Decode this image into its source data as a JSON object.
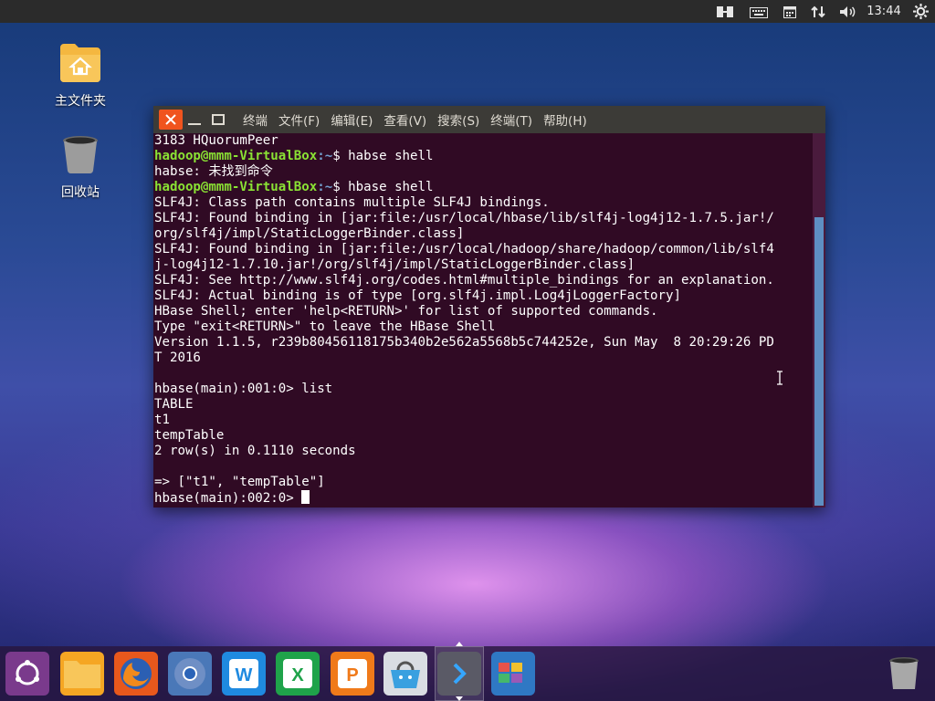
{
  "top_panel": {
    "clock": "13:44",
    "indicators": [
      "network-icon",
      "keyboard-icon",
      "calendar-icon",
      "transfer-icon",
      "volume-icon",
      "settings-gear-icon"
    ]
  },
  "desktop": {
    "icons": [
      {
        "label": "主文件夹",
        "icon": "home-folder-icon"
      },
      {
        "label": "回收站",
        "icon": "trash-icon"
      }
    ]
  },
  "terminal": {
    "menu": [
      "终端",
      "文件(F)",
      "编辑(E)",
      "查看(V)",
      "搜索(S)",
      "终端(T)",
      "帮助(H)"
    ],
    "prompt_user": "hadoop@mmm-VirtualBox",
    "prompt_path": ":~",
    "lines": [
      {
        "text": "3183 HQuorumPeer"
      },
      {
        "text": "$ habse shell",
        "prompt": true
      },
      {
        "text": "habse: 未找到命令"
      },
      {
        "text": "$ hbase shell",
        "prompt": true
      },
      {
        "text": "SLF4J: Class path contains multiple SLF4J bindings."
      },
      {
        "text": "SLF4J: Found binding in [jar:file:/usr/local/hbase/lib/slf4j-log4j12-1.7.5.jar!/"
      },
      {
        "text": "org/slf4j/impl/StaticLoggerBinder.class]"
      },
      {
        "text": "SLF4J: Found binding in [jar:file:/usr/local/hadoop/share/hadoop/common/lib/slf4"
      },
      {
        "text": "j-log4j12-1.7.10.jar!/org/slf4j/impl/StaticLoggerBinder.class]"
      },
      {
        "text": "SLF4J: See http://www.slf4j.org/codes.html#multiple_bindings for an explanation."
      },
      {
        "text": "SLF4J: Actual binding is of type [org.slf4j.impl.Log4jLoggerFactory]"
      },
      {
        "text": "HBase Shell; enter 'help<RETURN>' for list of supported commands."
      },
      {
        "text": "Type \"exit<RETURN>\" to leave the HBase Shell"
      },
      {
        "text": "Version 1.1.5, r239b80456118175b340b2e562a5568b5c744252e, Sun May  8 20:29:26 PD"
      },
      {
        "text": "T 2016"
      },
      {
        "text": ""
      },
      {
        "text": "hbase(main):001:0> list"
      },
      {
        "text": "TABLE"
      },
      {
        "text": "t1"
      },
      {
        "text": "tempTable"
      },
      {
        "text": "2 row(s) in 0.1110 seconds"
      },
      {
        "text": ""
      },
      {
        "text": "=> [\"t1\", \"tempTable\"]"
      },
      {
        "text": "hbase(main):002:0> ",
        "cursor": true
      }
    ]
  },
  "dock": {
    "items": [
      {
        "icon": "ubuntu-dash-icon",
        "color": "#7a3a8c"
      },
      {
        "icon": "files-folder-icon",
        "color": "#f5a623"
      },
      {
        "icon": "firefox-icon",
        "color": "#e8581c"
      },
      {
        "icon": "chromium-icon",
        "color": "#4a78b8"
      },
      {
        "icon": "wps-writer-icon",
        "color": "#1f8ae0"
      },
      {
        "icon": "wps-spreadsheet-icon",
        "color": "#1fa34a"
      },
      {
        "icon": "wps-presentation-icon",
        "color": "#f07a1a"
      },
      {
        "icon": "software-center-icon",
        "color": "#d9dde3"
      },
      {
        "icon": "terminal-app-icon",
        "color": "#5a5a66",
        "active": true
      },
      {
        "icon": "workspace-switcher-icon",
        "color": "#2f78c4"
      },
      {
        "icon": "trash-dock-icon",
        "color": "#9a9a9a"
      }
    ]
  }
}
